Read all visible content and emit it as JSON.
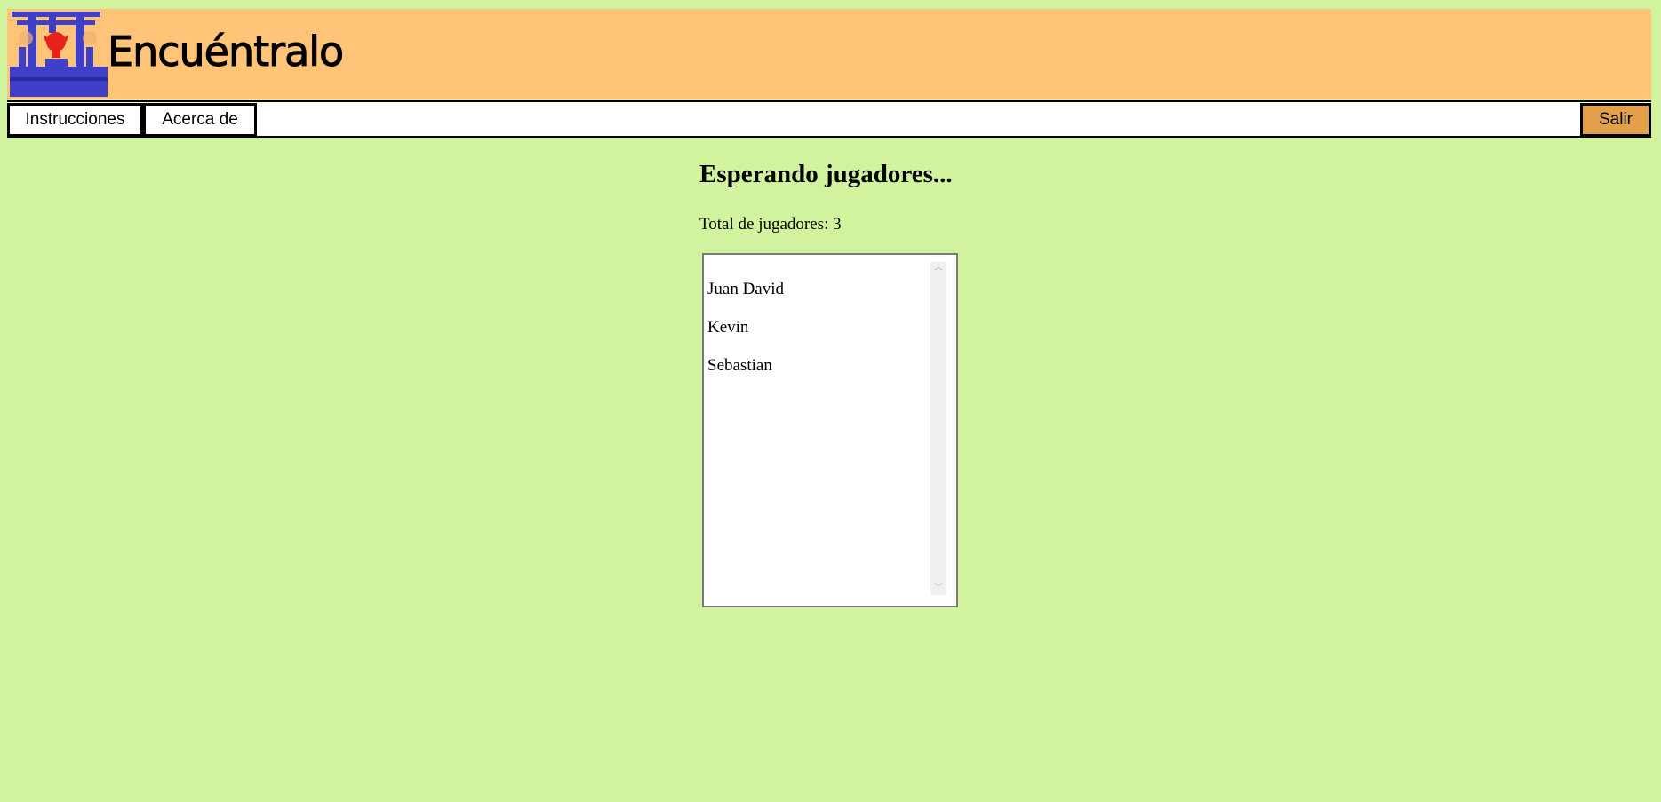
{
  "header": {
    "title": "Encuéntralo",
    "logo_icon": "torii-gate-logo-icon",
    "background_color": "#ffc478"
  },
  "nav": {
    "instructions_label": "Instrucciones",
    "about_label": "Acerca de",
    "exit_label": "Salir",
    "exit_color": "#e2a04b"
  },
  "main": {
    "heading": "Esperando jugadores...",
    "total_label": "Total de jugadores: 3",
    "players": [
      "Juan David",
      "Kevin",
      "Sebastian"
    ]
  },
  "page_background": "#d2f39e"
}
